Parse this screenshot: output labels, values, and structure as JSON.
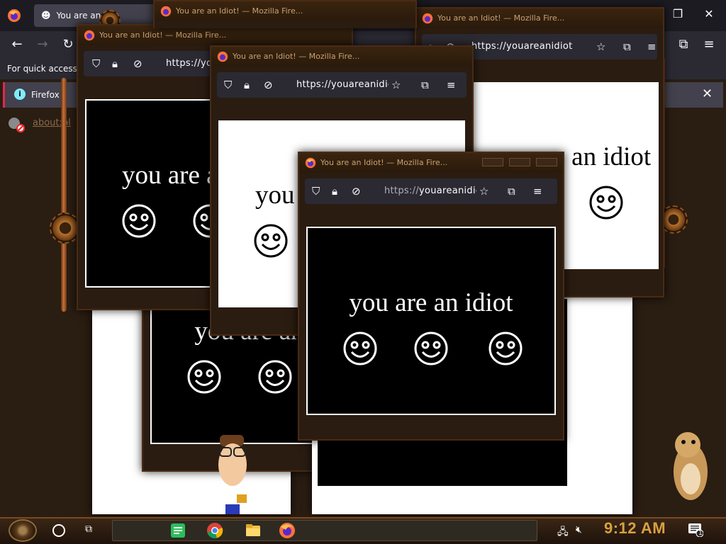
{
  "background_browser": {
    "tab_title": "You are an",
    "bookmark_hint": "For quick access",
    "notice_text": "Firefox",
    "about_link": "about:bl",
    "window_controls": [
      "—",
      "❐",
      "✕"
    ]
  },
  "popups": [
    {
      "title": "You are an Idiot! — Mozilla Fire...",
      "url": "https://youareanidiot",
      "text": "you are an idiot",
      "theme": "dark"
    },
    {
      "title": "You are an Idiot! — Mozilla Fire...",
      "url": "https://youareanidiot",
      "text": "you are an idiot",
      "theme": "light"
    },
    {
      "title": "You are an Idiot! — Mozilla Fire...",
      "url": "https://youareanidiot",
      "text": "you are an idiot",
      "theme": "dark"
    },
    {
      "title": "You are an Idiot! — Mozilla Fire...",
      "url": "https://youareanidiot",
      "text": "you are an idiot",
      "theme": "light"
    },
    {
      "title": "You are an Idiot! — Mozilla Fire...",
      "url": "https://youareanidiot",
      "text": "you are an idiot",
      "theme": "dark"
    },
    {
      "title": "You are an Idiot! — Mozilla Fire...",
      "url": "https://youareanidiot",
      "text": "you are an idiot",
      "theme": "dark"
    }
  ],
  "main_popup": {
    "title": "You are an Idiot! — Mozilla Fire...",
    "url_scheme": "https://",
    "url_host": "youareanidio",
    "text": "you are an idiot"
  },
  "taskbar": {
    "clock": "9:12 AM",
    "notification_count": "1",
    "apps": [
      "notes-app",
      "chrome",
      "file-explorer",
      "firefox"
    ]
  },
  "colors": {
    "accent_clock": "#d8a040",
    "firefox_orange": "#ff7139",
    "dark_page": "#000000",
    "light_page": "#ffffff"
  }
}
